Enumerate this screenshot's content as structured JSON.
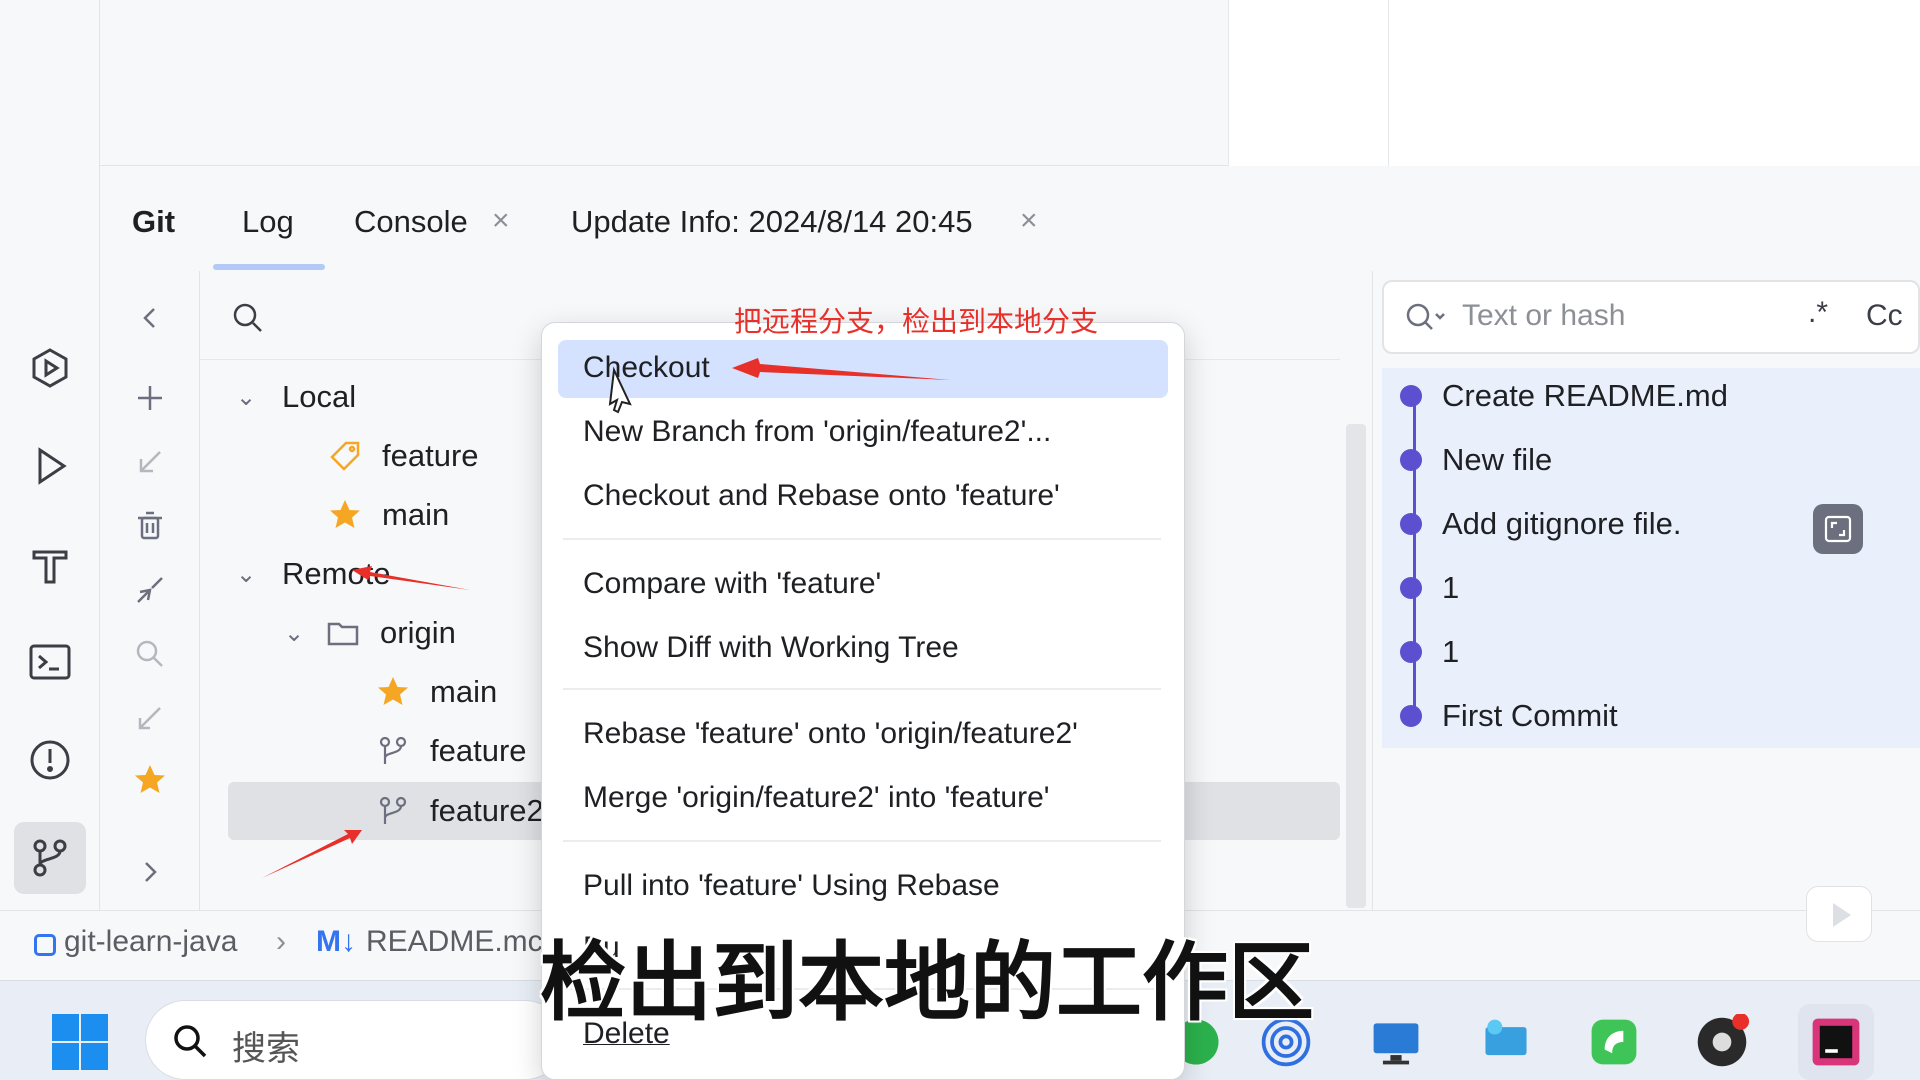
{
  "tabs": {
    "git": "Git",
    "log": "Log",
    "console": "Console",
    "update_info": "Update Info: 2024/8/14 20:45",
    "close_glyph": "×"
  },
  "branches": {
    "local_label": "Local",
    "local": [
      "feature",
      "main"
    ],
    "remote_label": "Remote",
    "origin_label": "origin",
    "remote_origin": [
      "main",
      "feature",
      "feature2"
    ]
  },
  "commit_search": {
    "placeholder": "Text or hash",
    "regex_toggle": ".*",
    "case_toggle": "Cc"
  },
  "commits": [
    "Create README.md",
    "New file",
    "Add gitignore file.",
    "1",
    "1",
    "First Commit"
  ],
  "context_menu": {
    "items": [
      "Checkout",
      "New Branch from 'origin/feature2'...",
      "Checkout and Rebase onto 'feature'",
      "Compare with 'feature'",
      "Show Diff with Working Tree",
      "Rebase 'feature' onto 'origin/feature2'",
      "Merge 'origin/feature2' into 'feature'",
      "Pull into 'feature' Using Rebase",
      "Pu",
      "Delete"
    ]
  },
  "breadcrumb": {
    "project": "git-learn-java",
    "file_badge": "M↓",
    "file": "README.mc"
  },
  "taskbar": {
    "search_placeholder": "搜索"
  },
  "annotations": {
    "arrow_note": "把远程分支，检出到本地分支",
    "subtitle": "检出到本地的工作区"
  },
  "colors": {
    "accent": "#3574f0",
    "menu_highlight": "#d4e2ff",
    "commit_dot": "#5c4fd0",
    "annotation_red": "#e8302a",
    "star": "#f5a623"
  }
}
